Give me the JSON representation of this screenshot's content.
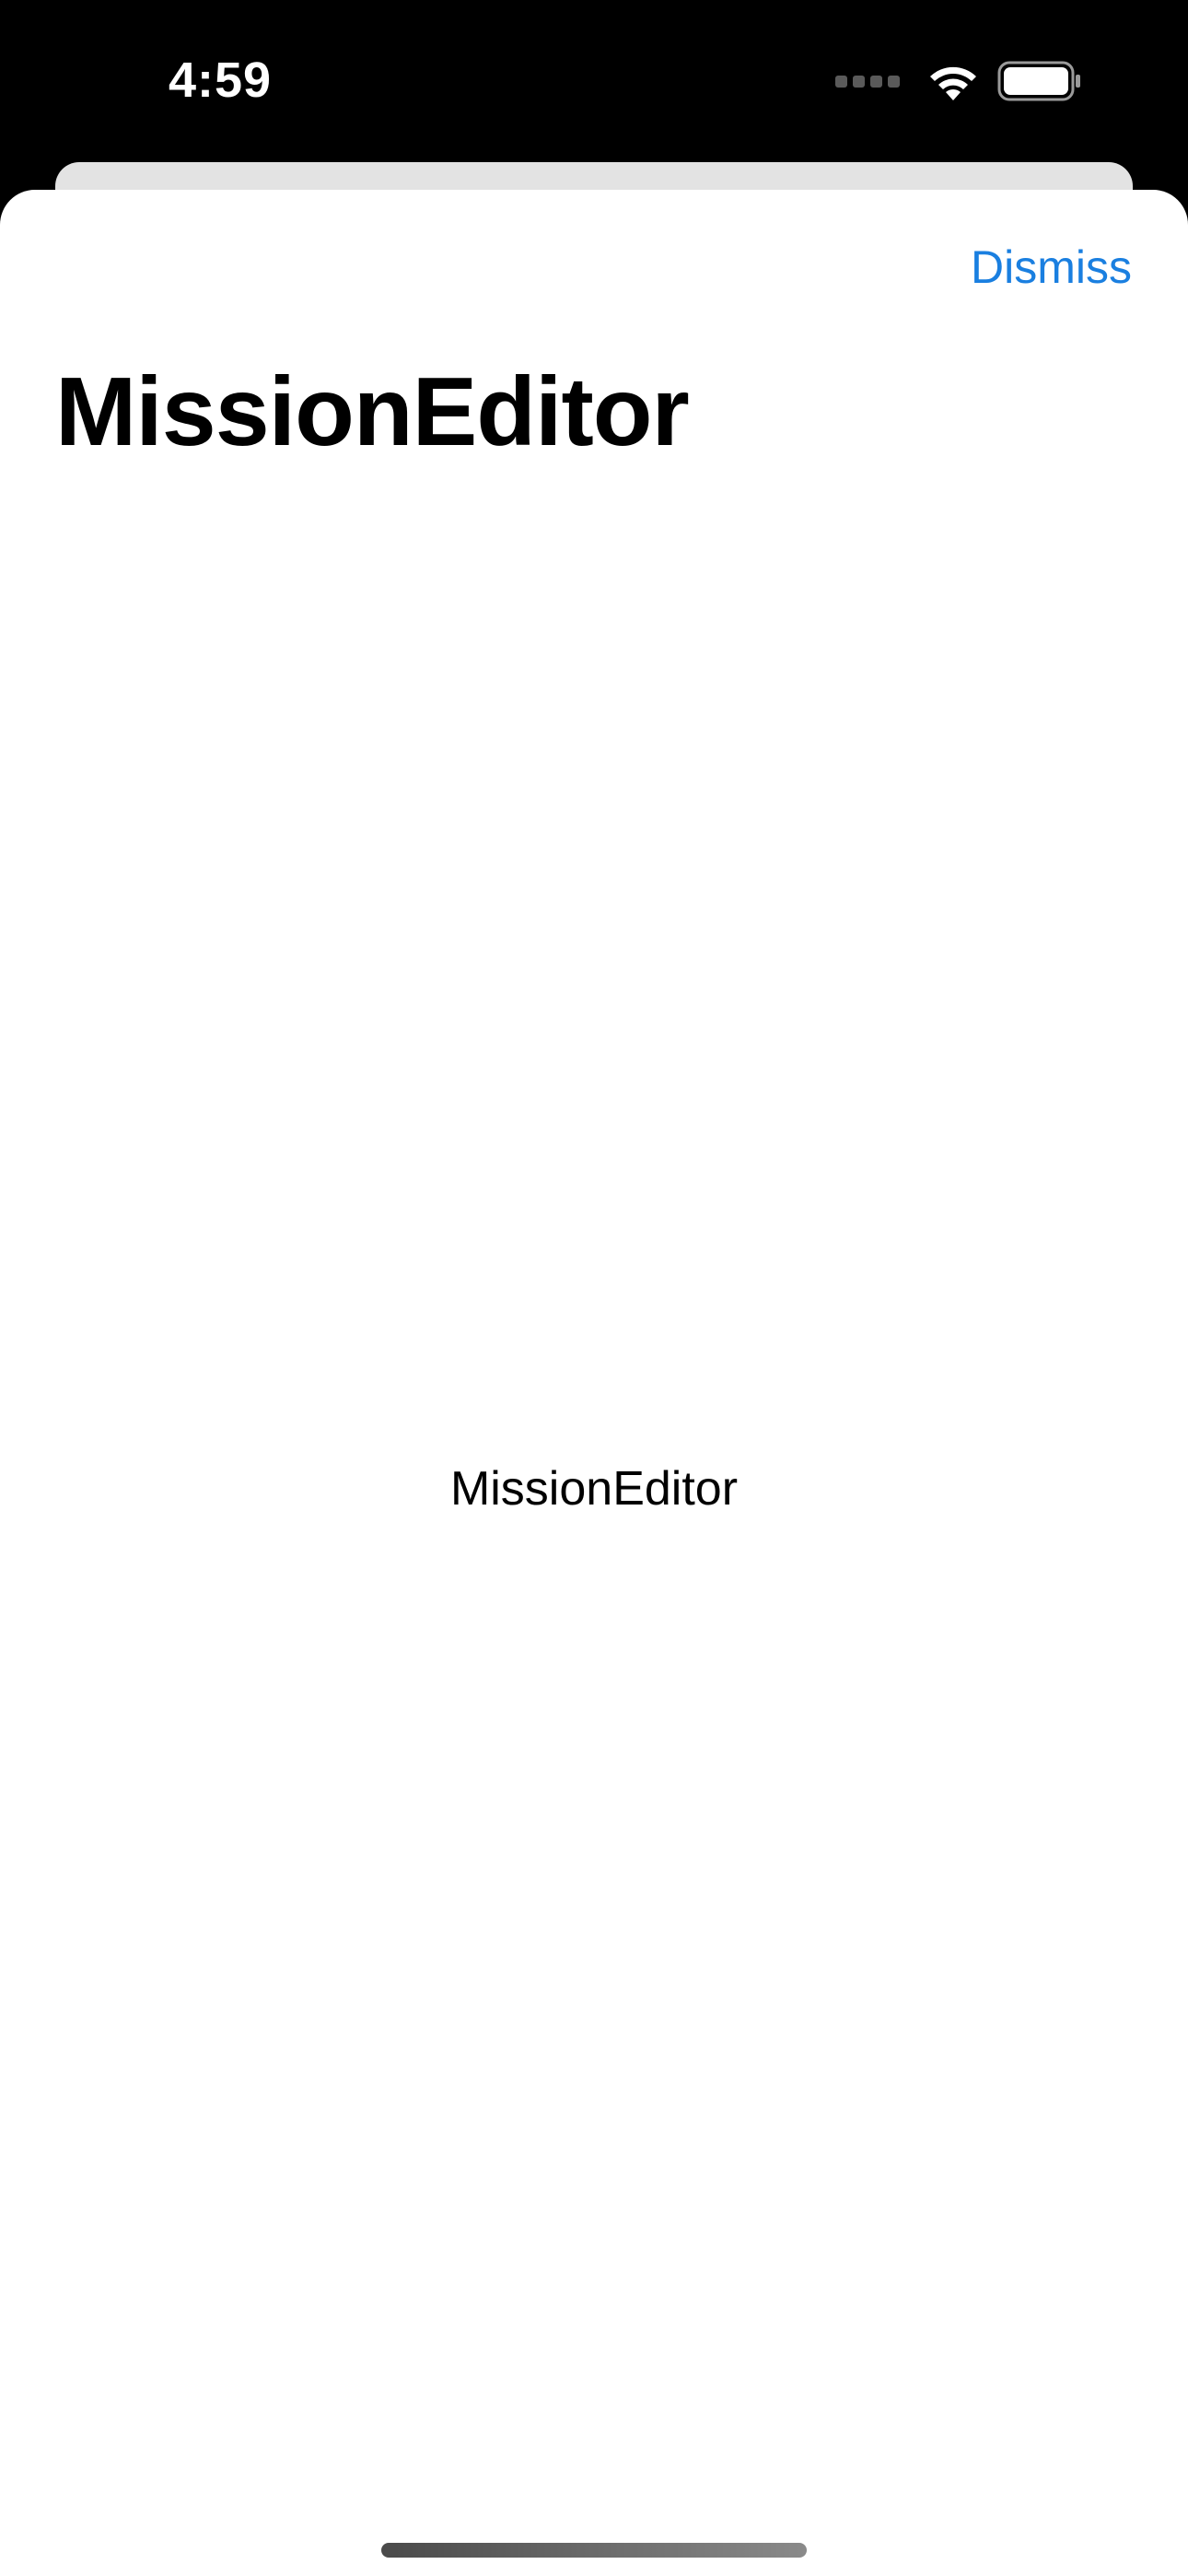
{
  "status_bar": {
    "time": "4:59",
    "icons": [
      "cellular-signal-icon",
      "wifi-icon",
      "battery-icon"
    ]
  },
  "sheet": {
    "dismiss_label": "Dismiss",
    "title": "MissionEditor",
    "body_text": "MissionEditor"
  },
  "colors": {
    "accent": "#1a7fe0",
    "background": "#ffffff",
    "status_bar_bg": "#000000"
  }
}
